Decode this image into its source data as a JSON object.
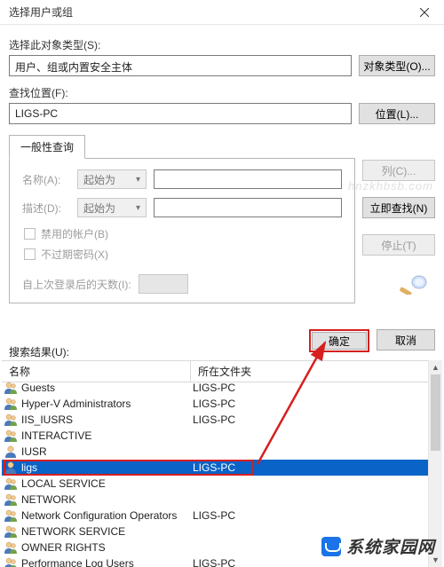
{
  "title": "选择用户或组",
  "labels": {
    "objectTypeSection": "选择此对象类型(S):",
    "locationSection": "查找位置(F):",
    "resultsLabel": "搜索结果(U):",
    "generalTab": "一般性查询",
    "nameLabel": "名称(A):",
    "descLabel": "描述(D):",
    "disabledAccount": "禁用的帐户(B)",
    "noExpirePwd": "不过期密码(X)",
    "lastLogonDays": "自上次登录后的天数(I):"
  },
  "fields": {
    "objectTypeValue": "用户、组或内置安全主体",
    "locationValue": "LIGS-PC",
    "nameMode": "起始为",
    "descMode": "起始为"
  },
  "buttons": {
    "objectTypes": "对象类型(O)...",
    "locations": "位置(L)...",
    "columns": "列(C)...",
    "findNow": "立即查找(N)",
    "stop": "停止(T)",
    "ok": "确定",
    "cancel": "取消"
  },
  "grid": {
    "col1": "名称",
    "col2": "所在文件夹"
  },
  "results": [
    {
      "name": "Guests",
      "folder": "LIGS-PC",
      "selected": false
    },
    {
      "name": "Hyper-V Administrators",
      "folder": "LIGS-PC",
      "selected": false
    },
    {
      "name": "IIS_IUSRS",
      "folder": "LIGS-PC",
      "selected": false
    },
    {
      "name": "INTERACTIVE",
      "folder": "",
      "selected": false
    },
    {
      "name": "IUSR",
      "folder": "",
      "selected": false
    },
    {
      "name": "ligs",
      "folder": "LIGS-PC",
      "selected": true
    },
    {
      "name": "LOCAL SERVICE",
      "folder": "",
      "selected": false
    },
    {
      "name": "NETWORK",
      "folder": "",
      "selected": false
    },
    {
      "name": "Network Configuration Operators",
      "folder": "LIGS-PC",
      "selected": false
    },
    {
      "name": "NETWORK SERVICE",
      "folder": "",
      "selected": false
    },
    {
      "name": "OWNER RIGHTS",
      "folder": "",
      "selected": false
    },
    {
      "name": "Performance Log Users",
      "folder": "LIGS-PC",
      "selected": false
    }
  ],
  "watermarks": {
    "top": "hnzkhbsb.com",
    "brand": "系统家园网"
  }
}
